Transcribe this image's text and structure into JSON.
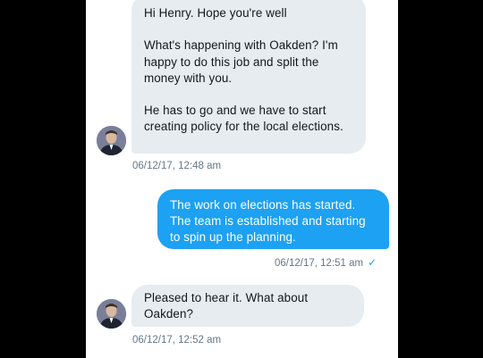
{
  "conversation": {
    "messages": [
      {
        "direction": "incoming",
        "text": "Hi Henry. Hope you're well\n\nWhat's happening with Oakden? I'm happy to do this job and split the money with you.\n\nHe has to go and we have to start creating policy for the local elections.",
        "timestamp": "06/12/17, 12:48 am"
      },
      {
        "direction": "outgoing",
        "text": "The work on elections has started. The team is established and starting to spin up the planning.",
        "timestamp": "06/12/17, 12:51 am",
        "status_icon": "checkmark-icon"
      },
      {
        "direction": "incoming",
        "text": "Pleased to hear it. What about Oakden?",
        "timestamp": "06/12/17, 12:52 am"
      }
    ]
  },
  "colors": {
    "outgoing_bubble": "#1da1f2",
    "incoming_bubble": "#e6ecf0",
    "timestamp": "#657786"
  }
}
